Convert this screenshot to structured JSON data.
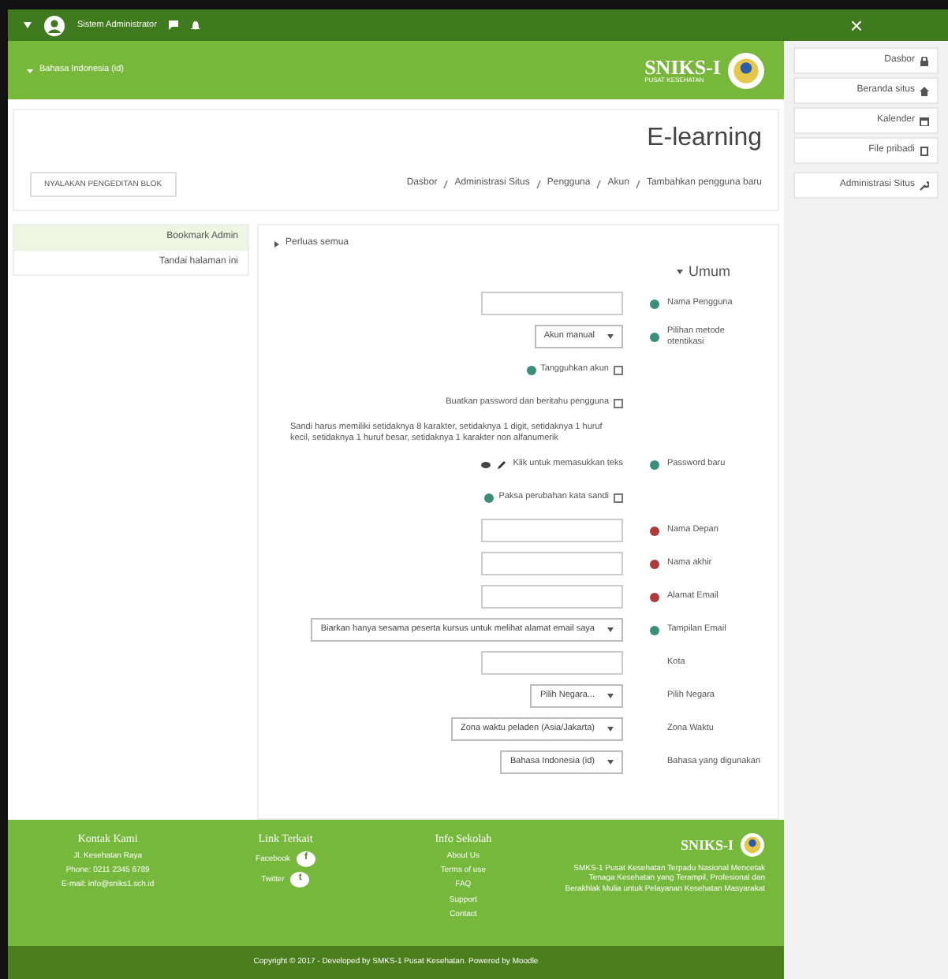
{
  "topbar": {
    "user_name": "Sistem Administrator",
    "close": "×"
  },
  "header": {
    "language": "Bahasa Indonesia (id)",
    "logo_title": "SNIKS-I",
    "logo_subtitle": "PUSAT KESEHATAN"
  },
  "drawer": [
    {
      "label": "Dasbor",
      "kind": "dashboard"
    },
    {
      "label": "Beranda situs",
      "kind": "home"
    },
    {
      "label": "Kalender",
      "kind": "calendar"
    },
    {
      "label": "File pribadi",
      "kind": "file"
    },
    {
      "label": "Administrasi Situs",
      "kind": "wrench"
    }
  ],
  "page_title": "E-learning",
  "breadcrumb": [
    "Dasbor",
    "Administrasi Situs",
    "Pengguna",
    "Akun",
    "Tambahkan pengguna baru"
  ],
  "edit_button": "NYALAKAN PENGEDITAN BLOK",
  "bookmarks": {
    "title": "Bookmark Admin",
    "items": [
      "Tandai halaman ini"
    ]
  },
  "form": {
    "expand_all": "Perluas semua",
    "section": "Umum",
    "fields": [
      {
        "kind": "text",
        "label": "Nama Pengguna",
        "help": true,
        "required": false
      },
      {
        "kind": "select",
        "label": "Pilihan metode otentikasi",
        "help": true,
        "required": false,
        "value": "Akun manual"
      },
      {
        "kind": "checkbox",
        "label": "Tangguhkan akun",
        "checked": false,
        "help": true
      },
      {
        "kind": "checkbox",
        "label": "Buatkan password dan beritahu pengguna",
        "checked": false,
        "help": false
      },
      {
        "kind": "note",
        "text": "Sandi harus memiliki setidaknya 8 karakter, setidaknya 1 digit, setidaknya 1 huruf kecil, setidaknya 1 huruf besar, setidaknya 1 karakter non alfanumerik"
      },
      {
        "kind": "password",
        "label": "Password baru",
        "help": true,
        "required": false,
        "value": "Klik untuk memasukkan teks"
      },
      {
        "kind": "checkbox",
        "label": "Paksa perubahan kata sandi",
        "checked": false,
        "help": true
      },
      {
        "kind": "text",
        "label": "Nama Depan",
        "help": false,
        "required": true
      },
      {
        "kind": "text",
        "label": "Nama akhir",
        "help": false,
        "required": true
      },
      {
        "kind": "text",
        "label": "Alamat Email",
        "help": false,
        "required": true
      },
      {
        "kind": "select",
        "label": "Tampilan Email",
        "help": true,
        "required": false,
        "value": "Biarkan hanya sesama peserta kursus untuk melihat alamat email saya"
      },
      {
        "kind": "text",
        "label": "Kota",
        "help": false,
        "required": false
      },
      {
        "kind": "select",
        "label": "Pilih Negara",
        "help": false,
        "required": false,
        "value": "Pilih Negara..."
      },
      {
        "kind": "select",
        "label": "Zona Waktu",
        "help": false,
        "required": false,
        "value": "Zona waktu peladen (Asia/Jakarta)"
      },
      {
        "kind": "select",
        "label": "Bahasa yang digunakan",
        "help": false,
        "required": false,
        "value": "Bahasa Indonesia (id)"
      }
    ]
  },
  "footer": {
    "logo_title": "SNIKS-I",
    "description": "SMKS-1 Pusat Kesehatan Terpadu Nasional Mencetak Tenaga Kesehatan yang Terampil, Profesional dan Berakhlak Mulia untuk Pelayanan Kesehatan Masyarakat",
    "columns": [
      {
        "title": "Kontak Kami",
        "kind": "contact",
        "items": [
          "Jl. Kesehatan Raya",
          "Phone: 0211 2345 6789",
          "E-mail: info@sniks1.sch.id"
        ]
      },
      {
        "title": "Link Terkait",
        "kind": "social",
        "items": [
          {
            "badge": "f",
            "label": "Facebook"
          },
          {
            "badge": "t",
            "label": "Twitter"
          }
        ]
      },
      {
        "title": "Info Sekolah",
        "kind": "links",
        "items": [
          "About Us",
          "Terms of use",
          "FAQ",
          "Support",
          "Contact"
        ]
      }
    ],
    "copyright": "Copyright © 2017 - Developed by SMKS-1 Pusat Kesehatan. Powered by Moodle"
  }
}
